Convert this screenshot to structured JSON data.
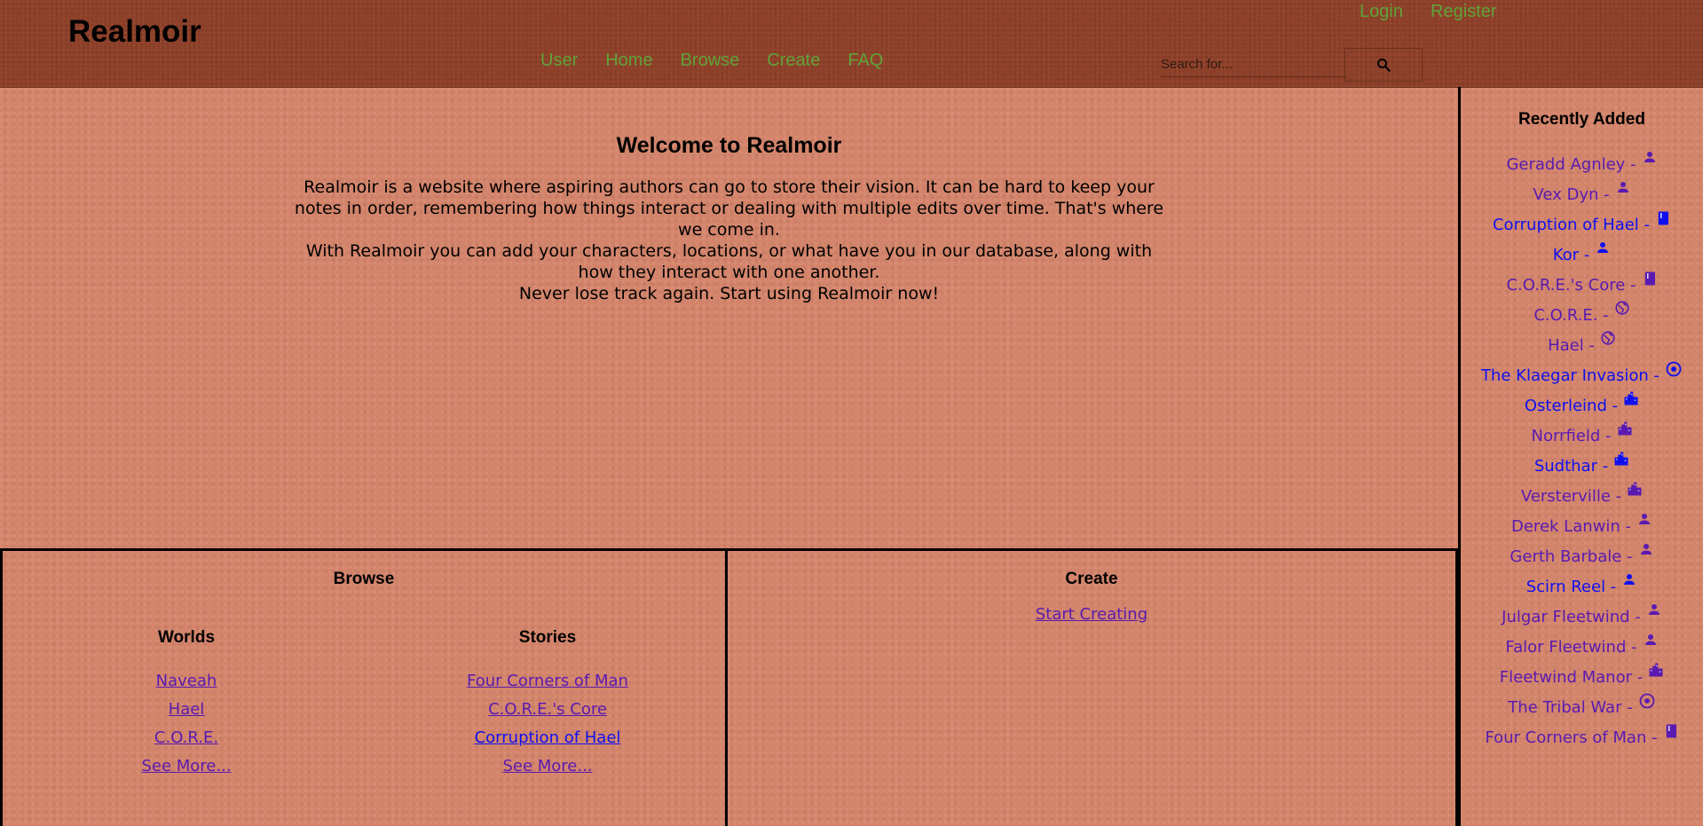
{
  "header": {
    "logo": "Realmoir",
    "login_label": "Login",
    "register_label": "Register",
    "nav": [
      "User",
      "Home",
      "Browse",
      "Create",
      "FAQ"
    ],
    "search": {
      "placeholder": "Search for...",
      "value": ""
    }
  },
  "welcome": {
    "title": "Welcome to Realmoir",
    "body_lines": [
      "Realmoir is a website where aspiring authors can go to store their vision. It can be hard to keep your notes in order, remembering how things interact or dealing with multiple edits over time. That's where we come in.",
      "With Realmoir you can add your characters, locations, or what have you in our database, along with how they interact with one another.",
      "Never lose track again. Start using Realmoir now!"
    ]
  },
  "recent": {
    "title": "Recently Added",
    "items": [
      {
        "label": "Geradd Agnley -",
        "icon": "person-icon",
        "visited": true
      },
      {
        "label": "Vex Dyn -",
        "icon": "person-icon",
        "visited": true
      },
      {
        "label": "Corruption of Hael -",
        "icon": "book-icon",
        "visited": false
      },
      {
        "label": "Kor -",
        "icon": "person-icon",
        "visited": false
      },
      {
        "label": "C.O.R.E.'s Core -",
        "icon": "book-icon",
        "visited": true
      },
      {
        "label": "C.O.R.E. -",
        "icon": "globe-icon",
        "visited": true
      },
      {
        "label": "Hael -",
        "icon": "globe-icon",
        "visited": true
      },
      {
        "label": "The Klaegar Invasion -",
        "icon": "target-icon",
        "visited": false
      },
      {
        "label": "Osterleind -",
        "icon": "city-icon",
        "visited": false
      },
      {
        "label": "Norrfield -",
        "icon": "city-icon",
        "visited": true
      },
      {
        "label": "Sudthar -",
        "icon": "city-icon",
        "visited": false
      },
      {
        "label": "Versterville -",
        "icon": "city-icon",
        "visited": true
      },
      {
        "label": "Derek Lanwin -",
        "icon": "person-icon",
        "visited": true
      },
      {
        "label": "Gerth Barbale -",
        "icon": "person-icon",
        "visited": true
      },
      {
        "label": "Scirn Reel -",
        "icon": "person-icon",
        "visited": false
      },
      {
        "label": "Julgar Fleetwind -",
        "icon": "person-icon",
        "visited": true
      },
      {
        "label": "Falor Fleetwind -",
        "icon": "person-icon",
        "visited": true
      },
      {
        "label": "Fleetwind Manor -",
        "icon": "city-icon",
        "visited": true
      },
      {
        "label": "The Tribal War -",
        "icon": "target-icon",
        "visited": true
      },
      {
        "label": "Four Corners of Man -",
        "icon": "book-icon",
        "visited": true
      }
    ]
  },
  "browse": {
    "title": "Browse",
    "worlds": {
      "title": "Worlds",
      "links": [
        {
          "label": "Naveah",
          "visited": true
        },
        {
          "label": "Hael",
          "visited": true
        },
        {
          "label": "C.O.R.E.",
          "visited": true
        },
        {
          "label": "See More...",
          "visited": true
        }
      ]
    },
    "stories": {
      "title": "Stories",
      "links": [
        {
          "label": "Four Corners of Man",
          "visited": true
        },
        {
          "label": "C.O.R.E.'s Core",
          "visited": true
        },
        {
          "label": "Corruption of Hael",
          "visited": false
        },
        {
          "label": "See More...",
          "visited": true
        }
      ]
    }
  },
  "create": {
    "title": "Create",
    "link_label": "Start Creating"
  },
  "colors": {
    "header_bg": "#8e3f27",
    "body_bg": "#d4846a",
    "nav_green": "#5fa33a",
    "visited_link": "#5a1ab0",
    "unvisited_link": "#1010ee"
  }
}
